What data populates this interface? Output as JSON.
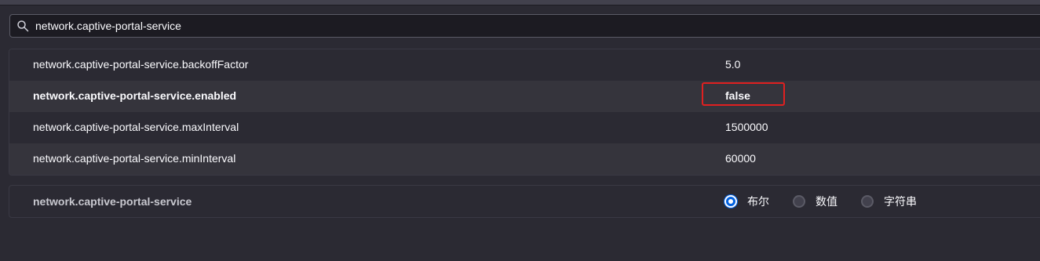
{
  "search": {
    "value": "network.captive-portal-service",
    "icon": "search-icon"
  },
  "prefs": [
    {
      "name": "network.captive-portal-service.backoffFactor",
      "value": "5.0",
      "modified": false
    },
    {
      "name": "network.captive-portal-service.enabled",
      "value": "false",
      "modified": true
    },
    {
      "name": "network.captive-portal-service.maxInterval",
      "value": "1500000",
      "modified": false
    },
    {
      "name": "network.captive-portal-service.minInterval",
      "value": "60000",
      "modified": false
    }
  ],
  "add_pref": {
    "name": "network.captive-portal-service",
    "types": [
      {
        "label": "布尔",
        "checked": true
      },
      {
        "label": "数值",
        "checked": false
      },
      {
        "label": "字符串",
        "checked": false
      }
    ]
  },
  "colors": {
    "background": "#2b2a33",
    "alt_row": "#35343c",
    "accent": "#0061e0",
    "highlight": "#e02020"
  }
}
